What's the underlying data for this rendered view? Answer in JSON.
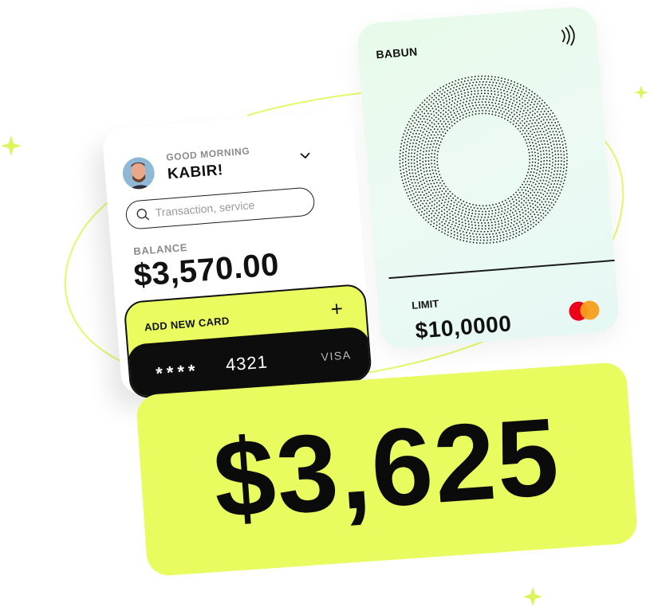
{
  "card": {
    "brand": "BABUN",
    "limit_label": "LIMIT",
    "limit_value": "$10,0000",
    "network_icon": "mastercard-icon",
    "contactless_icon": "nfc-icon"
  },
  "app": {
    "greeting": "GOOD MORNING",
    "user_name": "KABIR!",
    "search_placeholder": "Transaction, service",
    "balance_label": "BALANCE",
    "balance_value": "$3,570.00",
    "add_card_label": "ADD NEW CARD",
    "add_icon": "+",
    "card_mask": "****",
    "card_last4": "4321",
    "card_network": "VISA"
  },
  "highlight": {
    "amount": "$3,625"
  },
  "colors": {
    "accent_lime": "#e9fb5e",
    "card_gradient": "#e7fbe9",
    "dark": "#0d0d0d",
    "mastercard_red": "#eb001b",
    "mastercard_orange": "#f79e1b"
  }
}
